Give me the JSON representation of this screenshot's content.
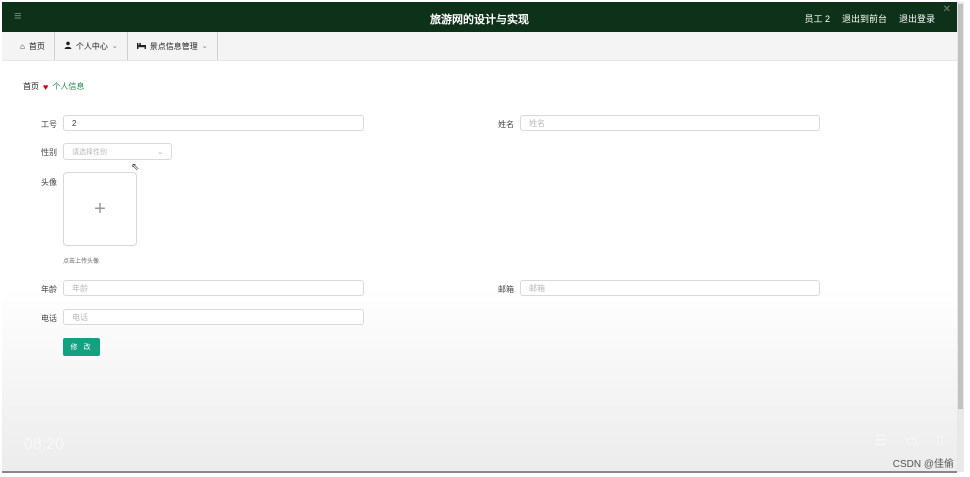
{
  "header": {
    "title": "旅游网的设计与实现",
    "user_label": "员工 2",
    "back_front": "退出到前台",
    "logout": "退出登录"
  },
  "nav": {
    "items": [
      {
        "icon": "home-icon",
        "label": "首页",
        "glyph": "⌂",
        "dropdown": false
      },
      {
        "icon": "user-icon",
        "label": "个人中心",
        "glyph": "👤",
        "dropdown": true
      },
      {
        "icon": "bed-icon",
        "label": "景点信息管理",
        "glyph": "✖",
        "dropdown": true
      }
    ]
  },
  "breadcrumb": {
    "home": "首页",
    "current": "个人信息"
  },
  "form": {
    "employee_no": {
      "label": "工号",
      "value": "2"
    },
    "name": {
      "label": "姓名",
      "placeholder": "姓名"
    },
    "gender": {
      "label": "性别",
      "placeholder": "请选择性别"
    },
    "avatar": {
      "label": "头像",
      "tip": "点击上传头像"
    },
    "age": {
      "label": "年龄",
      "placeholder": "年龄"
    },
    "email": {
      "label": "邮箱",
      "placeholder": "邮箱"
    },
    "phone": {
      "label": "电话",
      "placeholder": "电话"
    },
    "submit_label": "修 改"
  },
  "overlay": {
    "video_time": "08:20",
    "watermark": "CSDN @佳偷"
  },
  "colors": {
    "header_bg": "#0e3119",
    "accent": "#14a182",
    "breadcrumb_current": "#1d8b4a",
    "heart": "#d0021b"
  }
}
